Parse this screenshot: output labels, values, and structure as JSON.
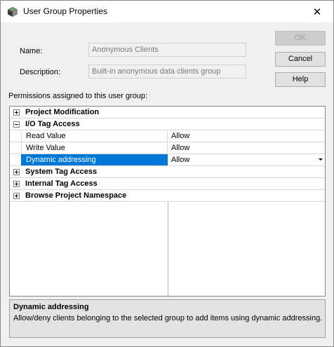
{
  "window": {
    "title": "User Group Properties",
    "app_icon": "cube-app-icon",
    "close_glyph": "✕"
  },
  "form": {
    "name_label": "Name:",
    "name_value": "Anonymous Clients",
    "description_label": "Description:",
    "description_value": "Built-in anonymous data clients group"
  },
  "buttons": {
    "ok": "OK",
    "cancel": "Cancel",
    "help": "Help"
  },
  "permissions": {
    "heading": "Permissions assigned to this user group:",
    "categories": [
      {
        "label": "Project Modification",
        "expanded": false
      },
      {
        "label": "I/O Tag Access",
        "expanded": true,
        "items": [
          {
            "name": "Read Value",
            "value": "Allow"
          },
          {
            "name": "Write Value",
            "value": "Allow"
          },
          {
            "name": "Dynamic addressing",
            "value": "Allow",
            "selected": true
          }
        ]
      },
      {
        "label": "System Tag Access",
        "expanded": false
      },
      {
        "label": "Internal Tag Access",
        "expanded": false
      },
      {
        "label": "Browse Project Namespace",
        "expanded": false
      }
    ]
  },
  "help_pane": {
    "title": "Dynamic addressing",
    "description": "Allow/deny clients belonging to the selected group to add items using dynamic addressing."
  },
  "colors": {
    "selection": "#0078d7",
    "window_bg": "#f0f0f0"
  }
}
